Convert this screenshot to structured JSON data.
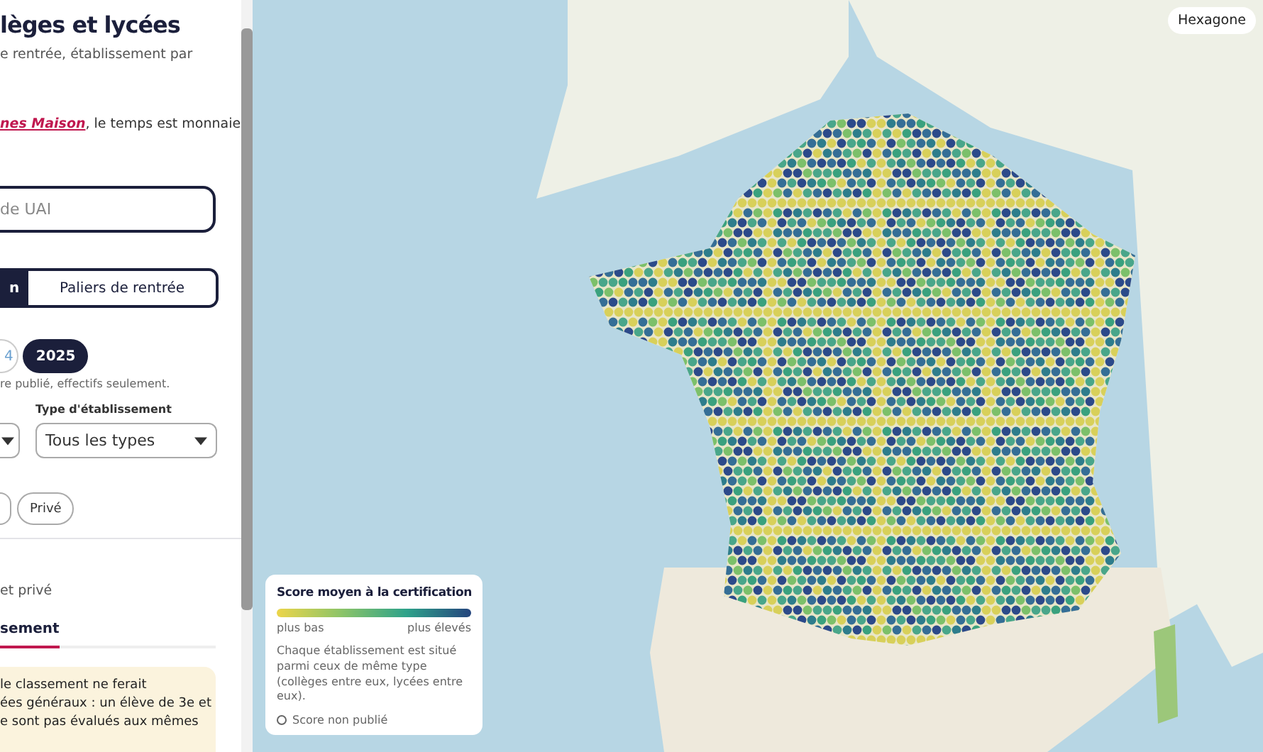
{
  "sidebar": {
    "title": "lèges et lycées",
    "subtitle": "e rentrée, établissement par",
    "credit_link": "nes Maison",
    "credit_text": ", le temps est monnaie",
    "search": {
      "placeholder": "de UAI"
    },
    "view_toggle": [
      {
        "label": "n",
        "selected": true
      },
      {
        "label": "Paliers de rentrée",
        "selected": false
      }
    ],
    "years": [
      {
        "label": "4",
        "selected": false
      },
      {
        "label": "2025",
        "selected": true
      }
    ],
    "year_note": "re publié, effectifs seulement.",
    "filters": [
      {
        "kind": "cut"
      },
      {
        "kind": "full",
        "label": "Type d'établissement",
        "value": "Tous les types"
      }
    ],
    "sector_chips": [
      {
        "selected": false
      },
      {
        "label": "Privé",
        "selected": false
      }
    ],
    "section_note": "et privé",
    "tabs": [
      {
        "label": "sement",
        "selected": true
      }
    ],
    "notice": [
      "le classement ne ferait",
      "ées généraux : un élève de 3e et",
      "e sont pas évalués aux mêmes"
    ]
  },
  "map": {
    "mode_button": "Hexagone",
    "legend": {
      "title": "Score moyen à la certification",
      "low": "plus bas",
      "high": "plus élevés",
      "description": "Chaque établissement est situé parmi ceux de même type (collèges entre eux, lycées entre eux).",
      "unpublished": "Score non publié"
    }
  }
}
